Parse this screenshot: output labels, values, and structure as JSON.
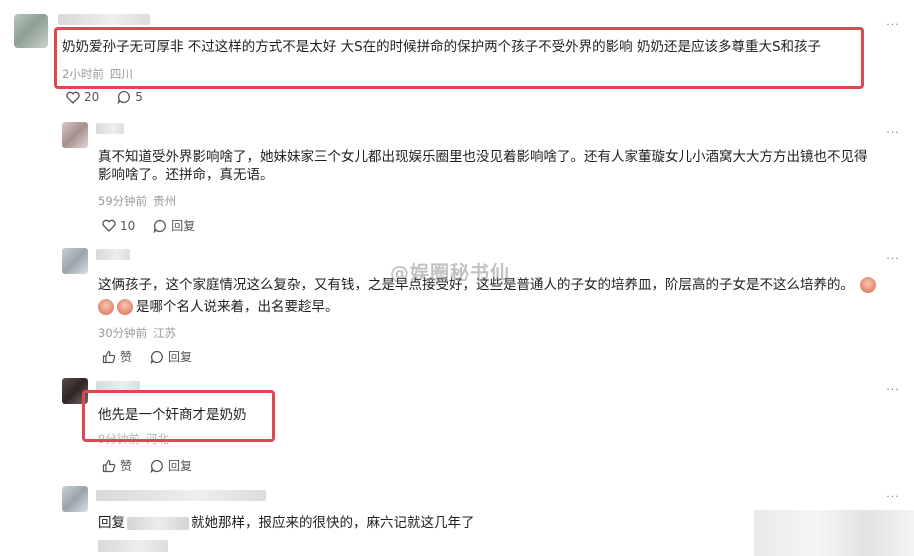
{
  "comments": [
    {
      "text": "奶奶爱孙子无可厚非 不过这样的方式不是太好 大S在的时候拼命的保护两个孩子不受外界的影响 奶奶还是应该多尊重大S和孩子",
      "time": "2小时前",
      "location": "四川",
      "likes": "20",
      "replies": "5"
    },
    {
      "text_line1": "真不知道受外界影响啥了，她妹妹家三个女儿都出现娱乐圈里也没见着影响啥了。还有人家董璇女儿小酒窝大大方方出镜也不见得",
      "text_line2": "影响啥了。还拼命，真无语。",
      "time": "59分钟前",
      "location": "贵州",
      "likes": "10",
      "reply_label": "回复"
    },
    {
      "text_line1a": "这俩孩子，这个家庭情况这么复杂，又有钱，",
      "text_line1b": "之是早点接受好，这些是普通人的子女的培养皿，阶层高的子女是不这么培养的。",
      "text_line2": "是哪个名人说来着，出名要趁早。",
      "time": "30分钟前",
      "location": "江苏",
      "like_label": "赞",
      "reply_label": "回复"
    },
    {
      "text": "他先是一个奸商才是奶奶",
      "time": "9分钟前",
      "location": "河北",
      "like_label": "赞",
      "reply_label": "回复"
    },
    {
      "prefix": "回复",
      "text": "就她那样，报应来的很快的，麻六记就这几年了"
    }
  ],
  "watermark": "@娱圈秘书仙",
  "more_glyph": "···"
}
